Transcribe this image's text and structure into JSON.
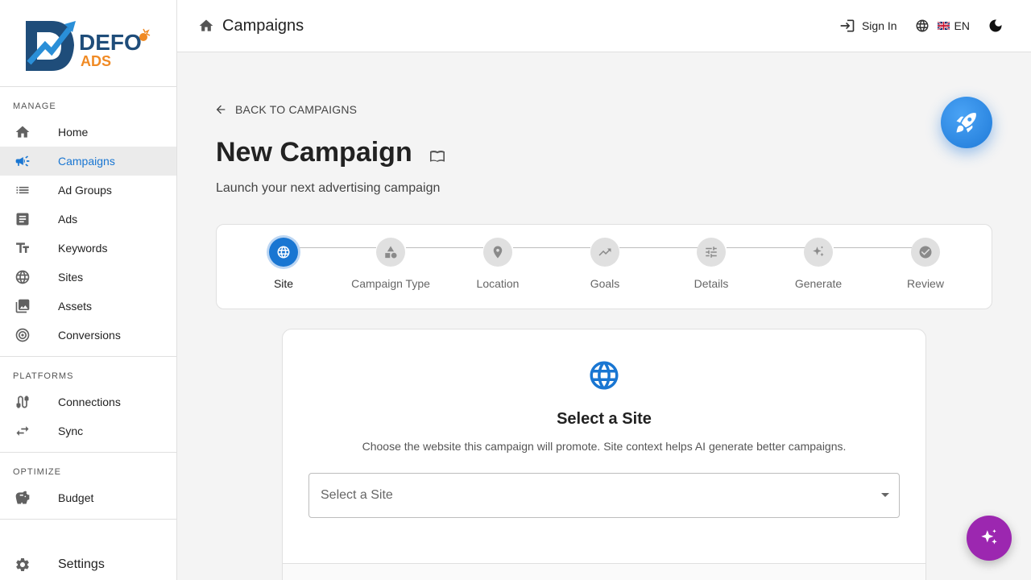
{
  "brand": {
    "name_top": "DEFO",
    "name_bottom": "ADS",
    "primary_color": "#1f4d7a",
    "accent_color": "#f08a24"
  },
  "sidebar": {
    "sections": [
      {
        "title": "MANAGE",
        "items": [
          {
            "label": "Home",
            "icon": "home-icon"
          },
          {
            "label": "Campaigns",
            "icon": "megaphone-icon",
            "active": true
          },
          {
            "label": "Ad Groups",
            "icon": "list-icon"
          },
          {
            "label": "Ads",
            "icon": "article-icon"
          },
          {
            "label": "Keywords",
            "icon": "text-fields-icon"
          },
          {
            "label": "Sites",
            "icon": "globe-icon"
          },
          {
            "label": "Assets",
            "icon": "image-icon"
          },
          {
            "label": "Conversions",
            "icon": "target-icon"
          }
        ]
      },
      {
        "title": "PLATFORMS",
        "items": [
          {
            "label": "Connections",
            "icon": "cable-icon"
          },
          {
            "label": "Sync",
            "icon": "sync-arrows-icon"
          }
        ]
      },
      {
        "title": "OPTIMIZE",
        "items": [
          {
            "label": "Budget",
            "icon": "piggy-bank-icon"
          }
        ]
      }
    ],
    "settings_label": "Settings"
  },
  "topbar": {
    "title": "Campaigns",
    "sign_in": "Sign In",
    "language": "EN"
  },
  "main": {
    "back_label": "BACK TO CAMPAIGNS",
    "title": "New Campaign",
    "subtitle": "Launch your next advertising campaign",
    "steps": [
      {
        "label": "Site",
        "icon": "globe-icon",
        "active": true
      },
      {
        "label": "Campaign Type",
        "icon": "shapes-icon"
      },
      {
        "label": "Location",
        "icon": "location-pin-icon"
      },
      {
        "label": "Goals",
        "icon": "trending-up-icon"
      },
      {
        "label": "Details",
        "icon": "tune-icon"
      },
      {
        "label": "Generate",
        "icon": "sparkle-icon"
      },
      {
        "label": "Review",
        "icon": "check-circle-icon"
      }
    ],
    "card": {
      "title": "Select a Site",
      "description": "Choose the website this campaign will promote. Site context helps AI generate better campaigns.",
      "select_placeholder": "Select a Site"
    }
  },
  "colors": {
    "primary": "#1976d2",
    "ai_fab": "#9c27b0"
  }
}
